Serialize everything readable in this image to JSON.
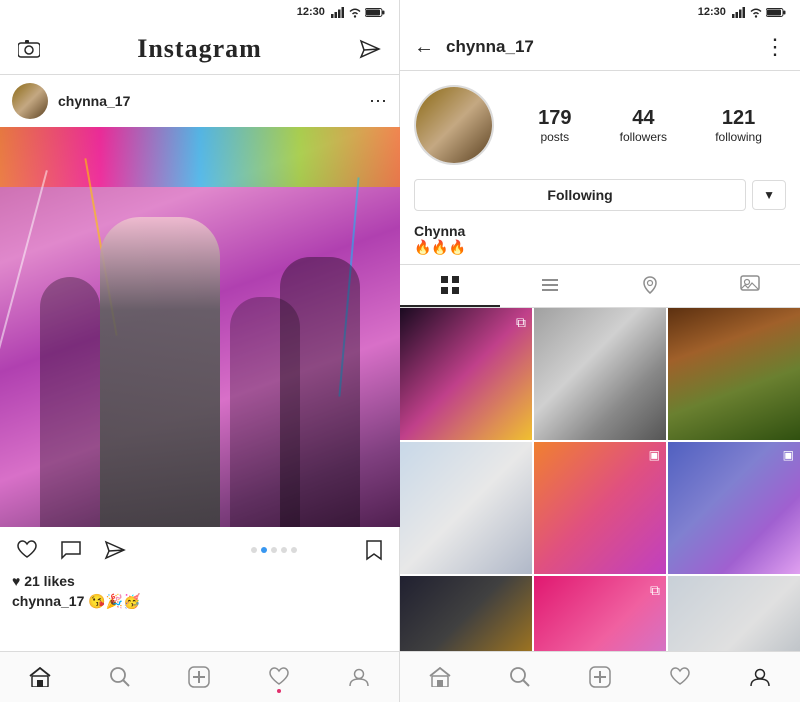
{
  "left": {
    "header": {
      "logo": "Instagram",
      "camera_label": "camera",
      "send_label": "send"
    },
    "post": {
      "username": "chynna_17",
      "likes": "♥ 21 likes",
      "caption_user": "chynna_17",
      "caption_text": "😘🎉🥳",
      "dots": [
        false,
        true,
        false,
        false,
        false
      ]
    },
    "nav": {
      "home": "⌂",
      "search": "⚲",
      "add": "+",
      "heart": "♥",
      "profile": "👤"
    },
    "status": {
      "time": "12:30",
      "signal": "▲",
      "wifi": "WiFi",
      "battery": "🔋"
    }
  },
  "right": {
    "header": {
      "back_label": "←",
      "username": "chynna_17",
      "more_label": "⋮"
    },
    "profile": {
      "posts_count": "179",
      "posts_label": "posts",
      "followers_count": "44",
      "followers_label": "followers",
      "following_count": "121",
      "following_label": "following",
      "following_btn": "Following",
      "dropdown_label": "▼",
      "display_name": "Chynna",
      "bio": "🔥🔥🔥"
    },
    "tabs": {
      "grid_label": "⊞",
      "list_label": "☰",
      "location_label": "📍",
      "tag_label": "👤"
    },
    "grid": {
      "cells": [
        {
          "class": "cell-1",
          "multi": true
        },
        {
          "class": "cell-2",
          "multi": false
        },
        {
          "class": "cell-3",
          "multi": false
        },
        {
          "class": "cell-4",
          "multi": false
        },
        {
          "class": "cell-5",
          "video": true
        },
        {
          "class": "cell-6",
          "video": true
        },
        {
          "class": "cell-7",
          "multi": false
        },
        {
          "class": "cell-8",
          "multi": true
        },
        {
          "class": "cell-9",
          "multi": false
        }
      ]
    },
    "status": {
      "time": "12:30"
    },
    "nav": {
      "home": "⌂",
      "search": "⚲",
      "add": "+",
      "heart": "♥",
      "profile": "👤"
    }
  }
}
